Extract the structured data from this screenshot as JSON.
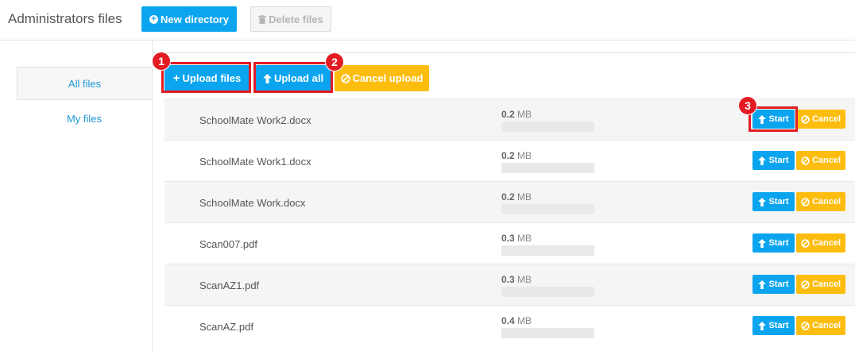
{
  "header": {
    "title": "Administrators files",
    "new_directory_label": "New directory",
    "delete_files_label": "Delete files"
  },
  "sidebar": {
    "items": [
      {
        "label": "All files",
        "active": true
      },
      {
        "label": "My files",
        "active": false
      }
    ]
  },
  "toolbar": {
    "upload_files_label": "Upload files",
    "upload_all_label": "Upload all",
    "cancel_upload_label": "Cancel upload"
  },
  "files": [
    {
      "name": "SchoolMate Work2.docx",
      "size_value": "0.2",
      "size_unit": "MB",
      "progress": 0
    },
    {
      "name": "SchoolMate Work1.docx",
      "size_value": "0.2",
      "size_unit": "MB",
      "progress": 0
    },
    {
      "name": "SchoolMate Work.docx",
      "size_value": "0.2",
      "size_unit": "MB",
      "progress": 0
    },
    {
      "name": "Scan007.pdf",
      "size_value": "0.3",
      "size_unit": "MB",
      "progress": 0
    },
    {
      "name": "ScanAZ1.pdf",
      "size_value": "0.3",
      "size_unit": "MB",
      "progress": 0
    },
    {
      "name": "ScanAZ.pdf",
      "size_value": "0.4",
      "size_unit": "MB",
      "progress": 0
    }
  ],
  "row_actions": {
    "start_label": "Start",
    "cancel_label": "Cancel"
  },
  "annotations": {
    "badge1": "1",
    "badge2": "2",
    "badge3": "3"
  },
  "colors": {
    "primary": "#0aa4ef",
    "warning": "#fdbd0e",
    "highlight": "#e31c23"
  }
}
